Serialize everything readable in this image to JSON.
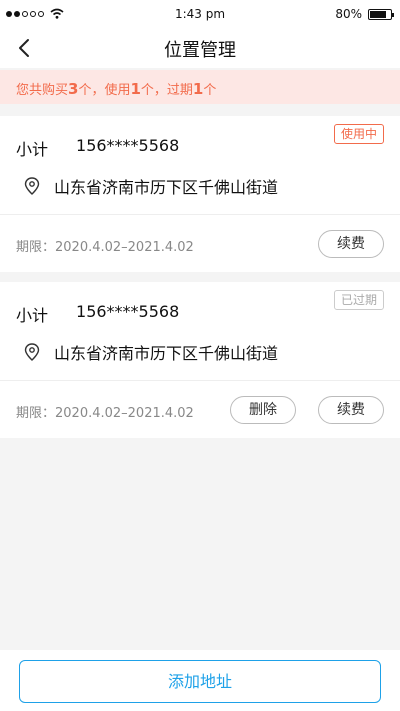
{
  "status_bar": {
    "time": "1:43 pm",
    "battery": "80%",
    "battery_level": 0.8
  },
  "nav": {
    "title": "位置管理"
  },
  "notice": {
    "prefix": "您共购买",
    "purchased": "3",
    "sep1": "个，使用",
    "used": "1",
    "sep2": "个，过期",
    "expired": "1",
    "suffix": "个"
  },
  "cards": [
    {
      "name": "小计",
      "phone": "156****5568",
      "badge": "使用中",
      "address": "山东省济南市历下区千佛山街道",
      "period": "期限：2020.4.02–2021.4.02",
      "renew_label": "续费"
    },
    {
      "name": "小计",
      "phone": "156****5568",
      "badge": "已过期",
      "address": "山东省济南市历下区千佛山街道",
      "period": "期限：2020.4.02–2021.4.02",
      "delete_label": "删除",
      "renew_label": "续费"
    }
  ],
  "footer": {
    "add_label": "添加地址"
  },
  "colors": {
    "accent": "#f26b4b",
    "primary": "#1ea1e8",
    "notice_bg": "#fde7e4"
  }
}
